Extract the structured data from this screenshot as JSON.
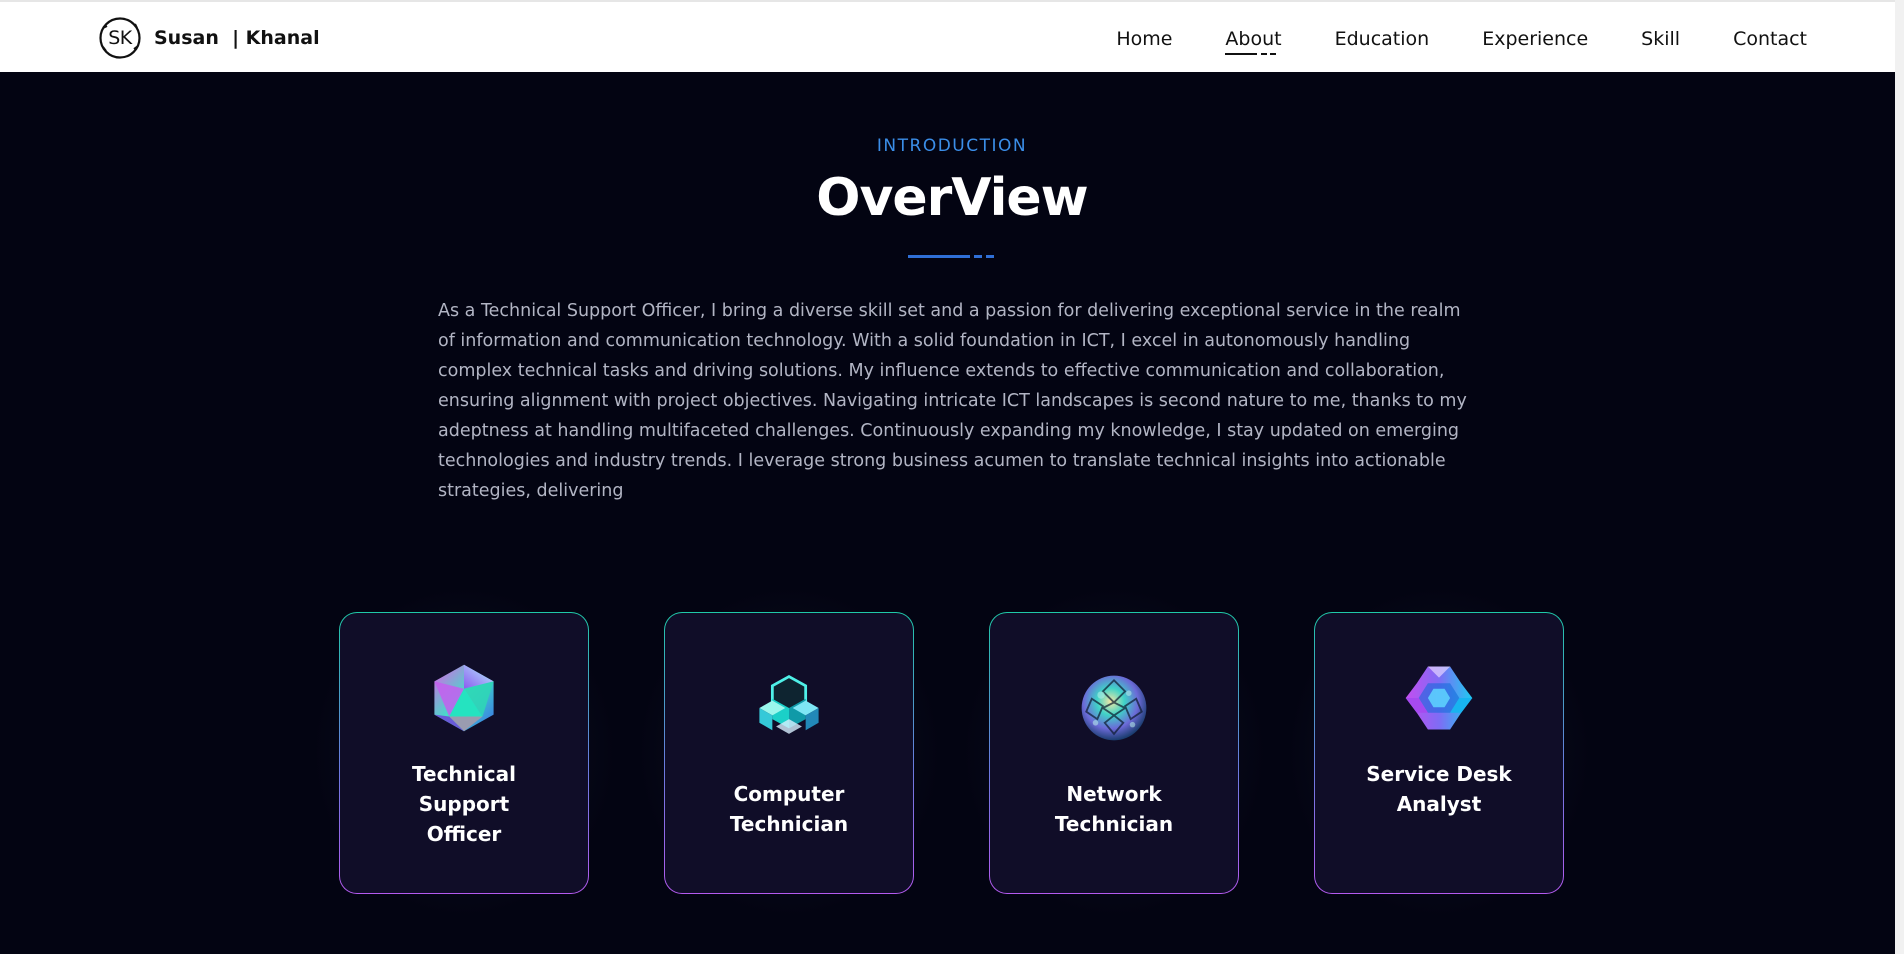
{
  "header": {
    "logo_text": "SK",
    "brand_name": "Susan  | Khanal",
    "nav": [
      {
        "label": "Home"
      },
      {
        "label": "About"
      },
      {
        "label": "Education"
      },
      {
        "label": "Experience"
      },
      {
        "label": "Skill"
      },
      {
        "label": "Contact"
      }
    ],
    "active_nav": "About"
  },
  "intro": {
    "eyebrow": "INTRODUCTION",
    "title": "OverView",
    "paragraph": "As a Technical Support Officer, I bring a diverse skill set and a passion for delivering exceptional service in the realm of information and communication technology. With a solid foundation in ICT, I excel in autonomously handling complex technical tasks and driving solutions. My influence extends to effective communication and collaboration, ensuring alignment with project objectives. Navigating intricate ICT landscapes is second nature to me, thanks to my adeptness at handling multifaceted challenges. Continuously expanding my knowledge, I stay updated on emerging technologies and industry trends. I leverage strong business acumen to translate technical insights into actionable strategies, delivering"
  },
  "cards": [
    {
      "title": "Technical Support Officer",
      "icon": "crystal-icosahedron-icon"
    },
    {
      "title": "Computer Technician",
      "icon": "crystal-cube-cluster-icon"
    },
    {
      "title": "Network Technician",
      "icon": "crystal-sphere-icon"
    },
    {
      "title": "Service Desk Analyst",
      "icon": "crystal-hexagon-icon"
    }
  ],
  "colors": {
    "background": "#030412",
    "accent_blue": "#3b8ee8",
    "card_background": "#100d28",
    "card_border_top": "#1fc9a8",
    "card_border_bottom": "#b45af0"
  }
}
